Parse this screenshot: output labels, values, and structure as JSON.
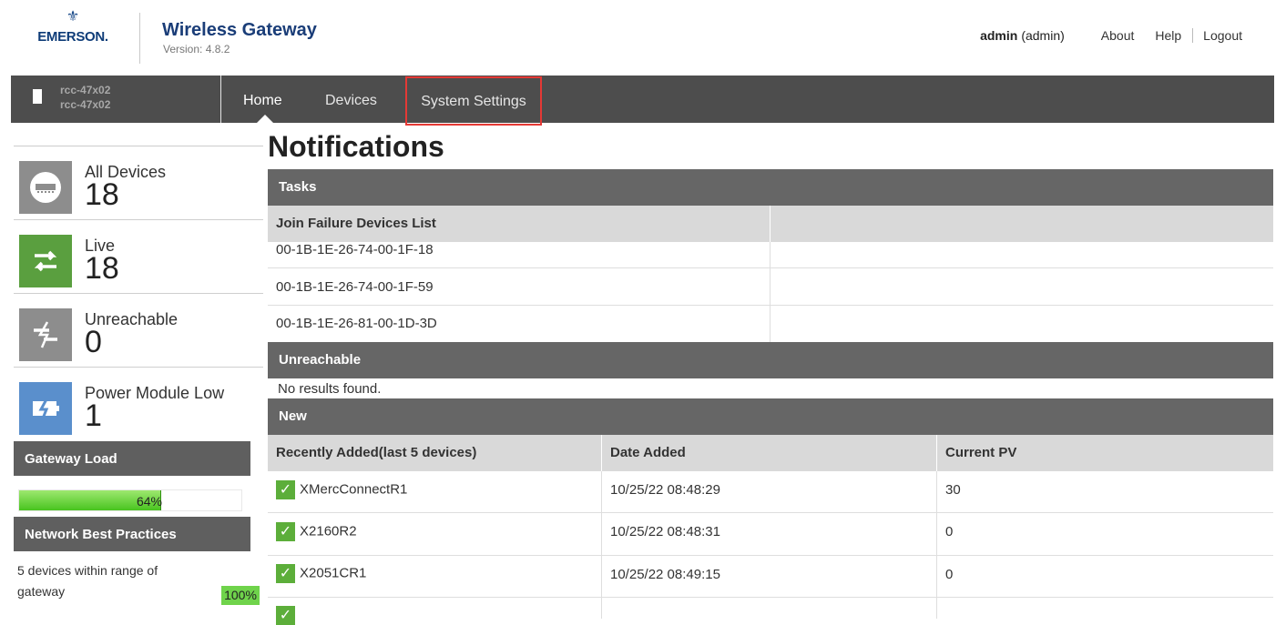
{
  "header": {
    "logo_text": "EMERSON.",
    "app_title": "Wireless Gateway",
    "version": "Version: 4.8.2",
    "user_name": "admin",
    "user_role": "(admin)",
    "links": {
      "about": "About",
      "help": "Help",
      "logout": "Logout"
    }
  },
  "nav": {
    "gateway_name_1": "rcc-47x02",
    "gateway_name_2": "rcc-47x02",
    "tabs": {
      "home": "Home",
      "devices": "Devices",
      "settings": "System Settings"
    }
  },
  "sidebar": {
    "stats": [
      {
        "label": "All Devices",
        "count": "18",
        "icon": "device-icon"
      },
      {
        "label": "Live",
        "count": "18",
        "icon": "live-arrows-icon"
      },
      {
        "label": "Unreachable",
        "count": "0",
        "icon": "unreachable-icon"
      },
      {
        "label": "Power Module Low",
        "count": "1",
        "icon": "battery-low-icon"
      }
    ],
    "gateway_load": {
      "title": "Gateway Load",
      "value": "64%",
      "fraction": 0.64
    },
    "best_practices": {
      "title": "Network Best Practices",
      "text": "5 devices within range of gateway",
      "value": "100%"
    }
  },
  "main": {
    "title": "Notifications",
    "tasks": {
      "title": "Tasks",
      "column": "Join Failure Devices List",
      "rows": [
        "00-1B-1E-26-74-00-1F-18",
        "00-1B-1E-26-74-00-1F-59",
        "00-1B-1E-26-81-00-1D-3D"
      ]
    },
    "unreachable": {
      "title": "Unreachable",
      "empty": "No results found."
    },
    "new": {
      "title": "New",
      "columns": [
        "Recently Added(last 5 devices)",
        "Date Added",
        "Current PV"
      ],
      "rows": [
        {
          "name": "XMercConnectR1",
          "date": "10/25/22 08:48:29",
          "pv": "30"
        },
        {
          "name": "X2160R2",
          "date": "10/25/22 08:48:31",
          "pv": "0"
        },
        {
          "name": "X2051CR1",
          "date": "10/25/22 08:49:15",
          "pv": "0"
        }
      ]
    }
  }
}
